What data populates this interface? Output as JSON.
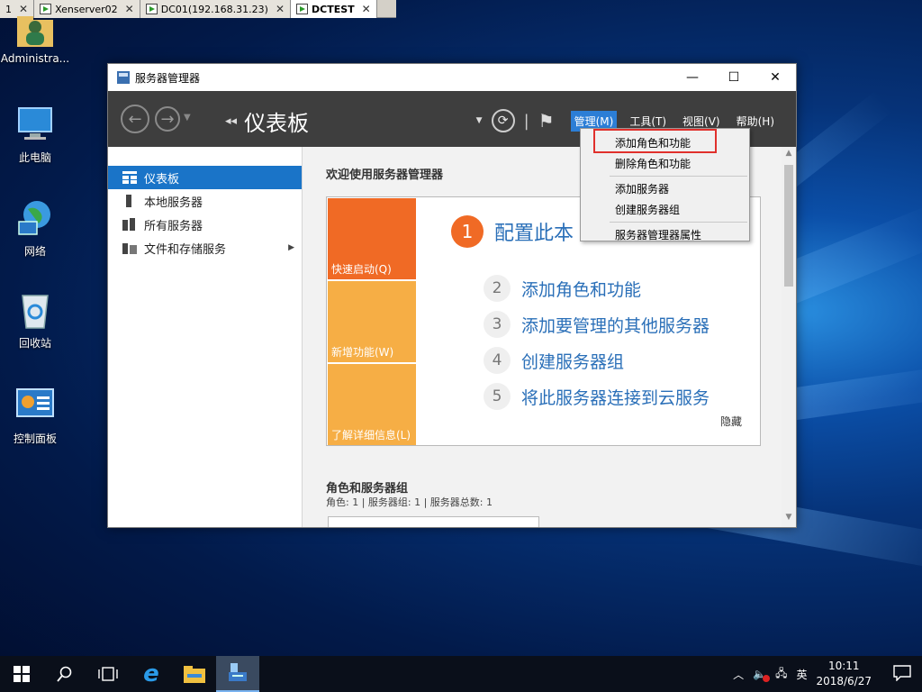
{
  "vm_tabs": [
    {
      "label": "1",
      "active": false
    },
    {
      "label": "Xenserver02",
      "active": false
    },
    {
      "label": "DC01(192.168.31.23)",
      "active": false
    },
    {
      "label": "DCTEST",
      "active": true
    }
  ],
  "desktop": {
    "icons": [
      {
        "label": "Administra...",
        "icon": "user-folder-icon"
      },
      {
        "label": "此电脑",
        "icon": "computer-icon"
      },
      {
        "label": "网络",
        "icon": "network-icon"
      },
      {
        "label": "回收站",
        "icon": "recycle-bin-icon"
      },
      {
        "label": "控制面板",
        "icon": "control-panel-icon"
      }
    ]
  },
  "window": {
    "title": "服务器管理器",
    "breadcrumb": "仪表板",
    "menu": {
      "manage": "管理(M)",
      "tools": "工具(T)",
      "view": "视图(V)",
      "help": "帮助(H)"
    },
    "sidebar": [
      {
        "label": "仪表板",
        "active": true
      },
      {
        "label": "本地服务器",
        "active": false
      },
      {
        "label": "所有服务器",
        "active": false
      },
      {
        "label": "文件和存储服务",
        "active": false
      }
    ],
    "welcome_title": "欢迎使用服务器管理器",
    "tiles": [
      "快速启动(Q)",
      "新增功能(W)",
      "了解详细信息(L)"
    ],
    "steps": [
      {
        "num": "1",
        "label": "配置此本"
      },
      {
        "num": "2",
        "label": "添加角色和功能"
      },
      {
        "num": "3",
        "label": "添加要管理的其他服务器"
      },
      {
        "num": "4",
        "label": "创建服务器组"
      },
      {
        "num": "5",
        "label": "将此服务器连接到云服务"
      }
    ],
    "hide_label": "隐藏",
    "roles_title": "角色和服务器组",
    "roles_summary": "角色: 1 | 服务器组: 1 | 服务器总数: 1"
  },
  "dropdown": {
    "items": [
      "添加角色和功能",
      "删除角色和功能",
      "添加服务器",
      "创建服务器组",
      "服务器管理器属性"
    ],
    "highlighted": "添加角色和功能"
  },
  "taskbar": {
    "tray_lang": "英",
    "time": "10:11",
    "date": "2018/6/27"
  },
  "colors": {
    "accent": "#1a74c8",
    "tile_orange": "#f06a25",
    "tile_yellow": "#f6ae45",
    "highlight_red": "#e0302c"
  }
}
